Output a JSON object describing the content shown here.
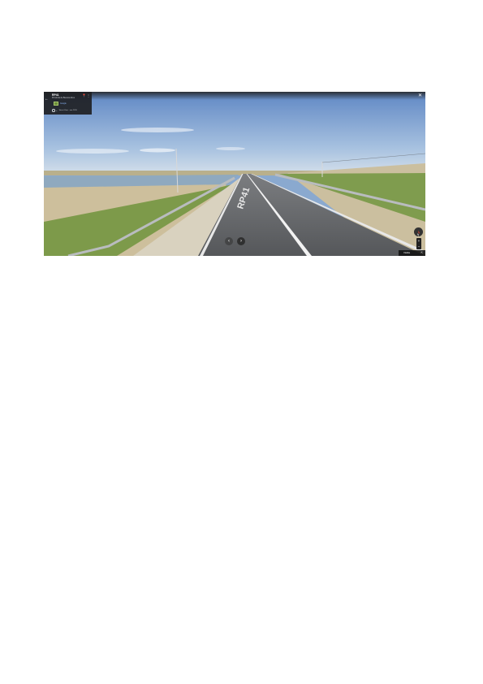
{
  "info_card": {
    "back_icon": "←",
    "title": "RP41",
    "subtitle": "Provincia de Buenos Aires",
    "pin_icon": "📍",
    "menu_icon": "⋮",
    "google_label": "Google",
    "history_icon": "⟲",
    "history_arrow": "▸",
    "history_label": "Street View · ene 2015"
  },
  "close_icon": "✕",
  "road_marking": "RP41",
  "nav": {
    "prev_icon": "‹",
    "next_icon": "›"
  },
  "zoom": {
    "in": "+",
    "out": "−"
  },
  "footer": {
    "label": "Visible",
    "icon": "⇱"
  },
  "colors": {
    "sky_top": "#5f87c4",
    "sky_bottom": "#c9d9ea",
    "water": "#8fa9bf",
    "grass": "#7d9a4a",
    "asphalt": "#5c5e61",
    "card": "#202124",
    "accent_link": "#8ab4f8"
  }
}
